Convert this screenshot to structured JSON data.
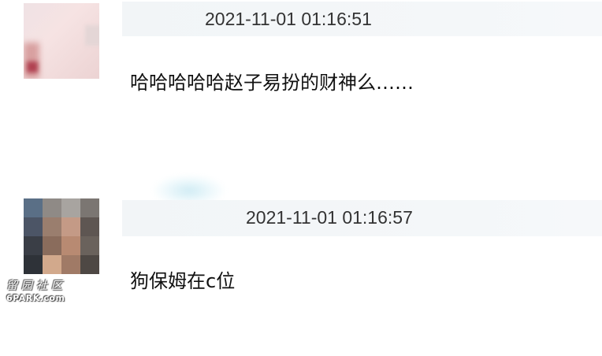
{
  "comments": [
    {
      "username": "",
      "timestamp": "2021-11-01 01:16:51",
      "text": "哈哈哈哈哈赵子易扮的财神么……"
    },
    {
      "username": "",
      "timestamp": "2021-11-01 01:16:57",
      "text": "狗保姆在c位"
    }
  ],
  "watermark": {
    "cn": "留园社区",
    "en": "6PARK.com"
  },
  "colors": {
    "header_strip": "#f2f5f7",
    "username": "#3b6ea8",
    "timestamp": "#333333",
    "body_text": "#111111"
  }
}
